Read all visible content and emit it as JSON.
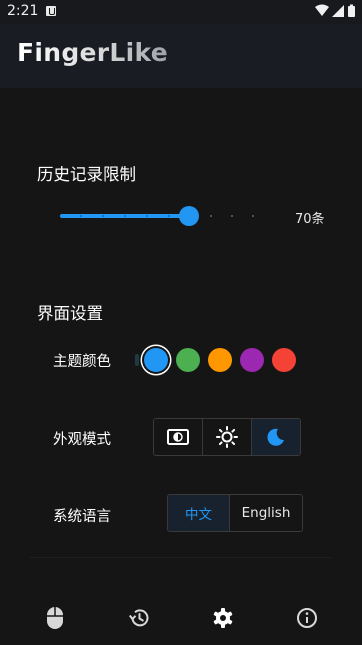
{
  "status_bar": {
    "time": "2:21"
  },
  "app": {
    "title": "FingerLike"
  },
  "history": {
    "title": "历史记录限制",
    "slider_value": 70,
    "value_label": "70条"
  },
  "ui_settings": {
    "title": "界面设置",
    "theme_color_label": "主题颜色",
    "theme_colors": [
      "#2196f3",
      "#4caf50",
      "#ff9800",
      "#9c27b0",
      "#f44336"
    ],
    "selected_color": "#2196f3",
    "appearance_label": "外观模式",
    "appearance_options": [
      "system-mode-icon",
      "light-mode-icon",
      "dark-mode-icon"
    ],
    "appearance_selected": "dark-mode-icon",
    "language_label": "系统语言",
    "language_options": {
      "zh": "中文",
      "en": "English"
    },
    "language_selected": "中文"
  },
  "bottom_nav": {
    "items": [
      "mouse-icon",
      "history-icon",
      "settings-icon",
      "info-icon"
    ],
    "active": "settings-icon"
  },
  "colors": {
    "accent": "#2196f3",
    "background": "#151515",
    "app_bar": "#191c22"
  }
}
